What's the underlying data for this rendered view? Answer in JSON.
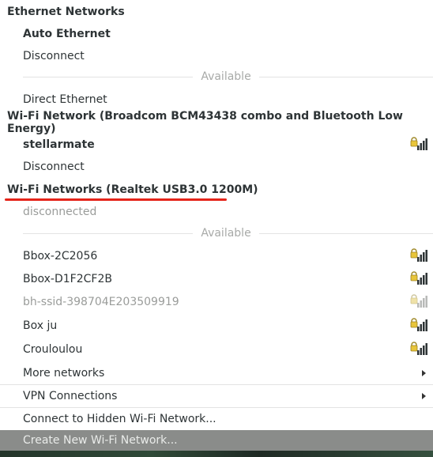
{
  "ethernet": {
    "header": "Ethernet Networks",
    "connection": "Auto Ethernet",
    "disconnect": "Disconnect",
    "available_label": "Available",
    "available_items": [
      "Direct Ethernet"
    ]
  },
  "wifi_broadcom": {
    "header": "Wi-Fi Network (Broadcom BCM43438 combo and Bluetooth Low Energy)",
    "connection": "stellarmate",
    "connection_icon": "wifi-locked-icon",
    "disconnect": "Disconnect"
  },
  "wifi_realtek": {
    "header": "Wi-Fi Networks (Realtek USB3.0 1200M)",
    "status": "disconnected",
    "available_label": "Available",
    "networks": [
      {
        "name": "Bbox-2C2056",
        "icon": "wifi-locked-icon",
        "enabled": true
      },
      {
        "name": "Bbox-D1F2CF2B",
        "icon": "wifi-locked-icon",
        "enabled": true
      },
      {
        "name": "bh-ssid-398704E203509919",
        "icon": "wifi-locked-icon",
        "enabled": false
      },
      {
        "name": "Box ju",
        "icon": "wifi-locked-icon",
        "enabled": true
      },
      {
        "name": "Crouloulou",
        "icon": "wifi-locked-icon",
        "enabled": true
      }
    ],
    "more": "More networks"
  },
  "vpn": {
    "label": "VPN Connections"
  },
  "actions": {
    "connect_hidden": "Connect to Hidden Wi-Fi Network...",
    "create_new": "Create New Wi-Fi Network..."
  },
  "colors": {
    "highlight_underline": "#e5241a",
    "selected_bg": "#8a8c8a"
  }
}
